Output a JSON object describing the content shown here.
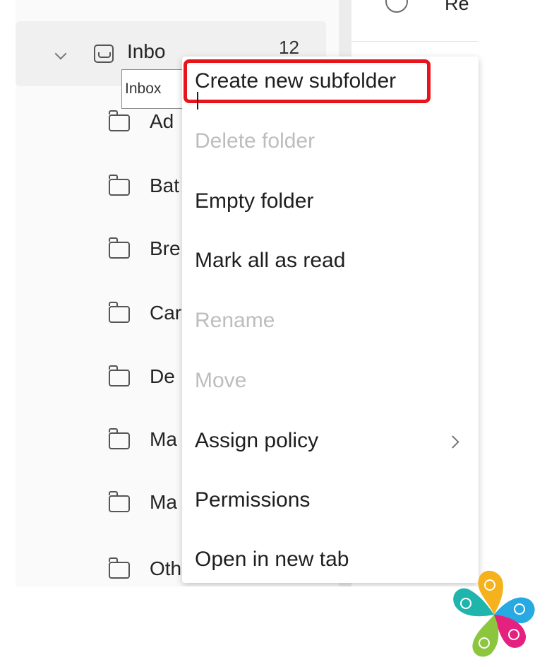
{
  "reading_pane": {
    "title_fragment": "Re"
  },
  "folders": {
    "inbox": {
      "label": "Inbo",
      "unread_count": "12"
    },
    "tooltip": "Inbox",
    "items": [
      {
        "label": "Ad"
      },
      {
        "label": "Bat"
      },
      {
        "label": "Bre"
      },
      {
        "label": "Car"
      },
      {
        "label": "De"
      },
      {
        "label": "Ma"
      },
      {
        "label": "Ma"
      },
      {
        "label": "Other"
      }
    ]
  },
  "context_menu": {
    "items": [
      {
        "label": "Create new subfolder",
        "enabled": true,
        "highlighted": true
      },
      {
        "label": "Delete folder",
        "enabled": false
      },
      {
        "label": "Empty folder",
        "enabled": true
      },
      {
        "label": "Mark all as read",
        "enabled": true
      },
      {
        "label": "Rename",
        "enabled": false
      },
      {
        "label": "Move",
        "enabled": false
      },
      {
        "label": "Assign policy",
        "enabled": true,
        "has_submenu": true
      },
      {
        "label": "Permissions",
        "enabled": true
      },
      {
        "label": "Open in new tab",
        "enabled": true
      }
    ]
  },
  "colors": {
    "highlight_border": "#e8141b",
    "disabled_text": "#bdbdbd",
    "accent_yellow": "#f2d700"
  },
  "logo": {
    "icon": "flower-logo-icon"
  }
}
